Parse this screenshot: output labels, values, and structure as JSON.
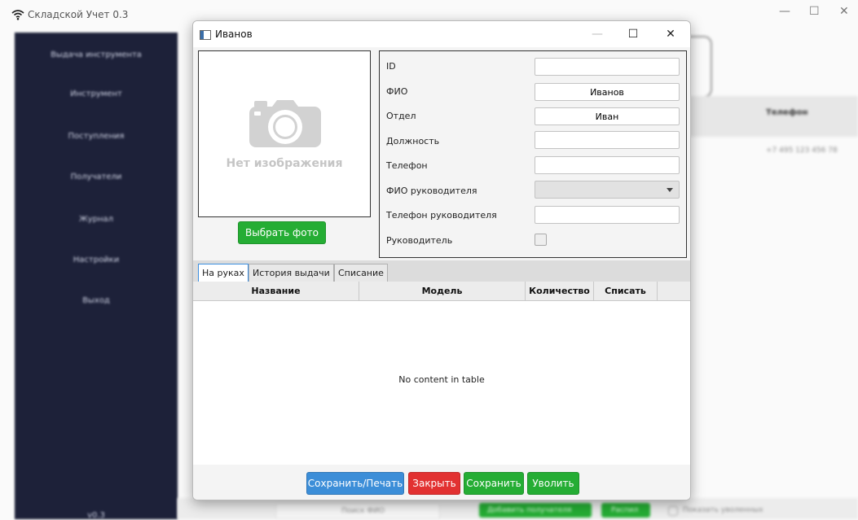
{
  "app": {
    "title": "Складской Учет 0.3",
    "sidebar_items": [
      "Выдача инструмента",
      "Инструмент",
      "Поступления",
      "Получатели",
      "Журнал",
      "Настройки",
      "Выход"
    ],
    "sidebar_footer": "v0.3",
    "table_header_phone": "Телефон",
    "table_cell_phone": "+7 495 123 456 78",
    "bottom_search": "Поиск ФИО",
    "bottom_add_button": "Добавить получателя",
    "bottom_report_button": "Распил",
    "bottom_checkbox_label": "Показать уволенных"
  },
  "dialog": {
    "title": "Иванов",
    "photo": {
      "placeholder_text": "Нет изображения",
      "choose_button": "Выбрать фото"
    },
    "form": {
      "id_label": "ID",
      "id_value": "",
      "fio_label": "ФИО",
      "fio_value": "Иванов",
      "department_label": "Отдел",
      "department_value": "Иван",
      "position_label": "Должность",
      "position_value": "",
      "phone_label": "Телефон",
      "phone_value": "",
      "manager_fio_label": "ФИО руководителя",
      "manager_fio_value": "",
      "manager_phone_label": "Телефон руководителя",
      "manager_phone_value": "",
      "is_manager_label": "Руководитель",
      "is_manager_checked": false
    },
    "tabs": [
      {
        "label": "На руках",
        "active": true
      },
      {
        "label": "История выдачи",
        "active": false
      },
      {
        "label": "Списание",
        "active": false
      }
    ],
    "table": {
      "columns": [
        "Название",
        "Модель",
        "Количество",
        "Списать"
      ],
      "empty_message": "No content in table"
    },
    "buttons": {
      "save_print": "Сохранить/Печать",
      "close": "Закрыть",
      "save": "Сохранить",
      "dismiss": "Уволить"
    }
  },
  "colors": {
    "sidebar": "#1d2139",
    "blue_button": "#3c8ed8",
    "red_button": "#e23131",
    "green_button": "#25ad34"
  }
}
